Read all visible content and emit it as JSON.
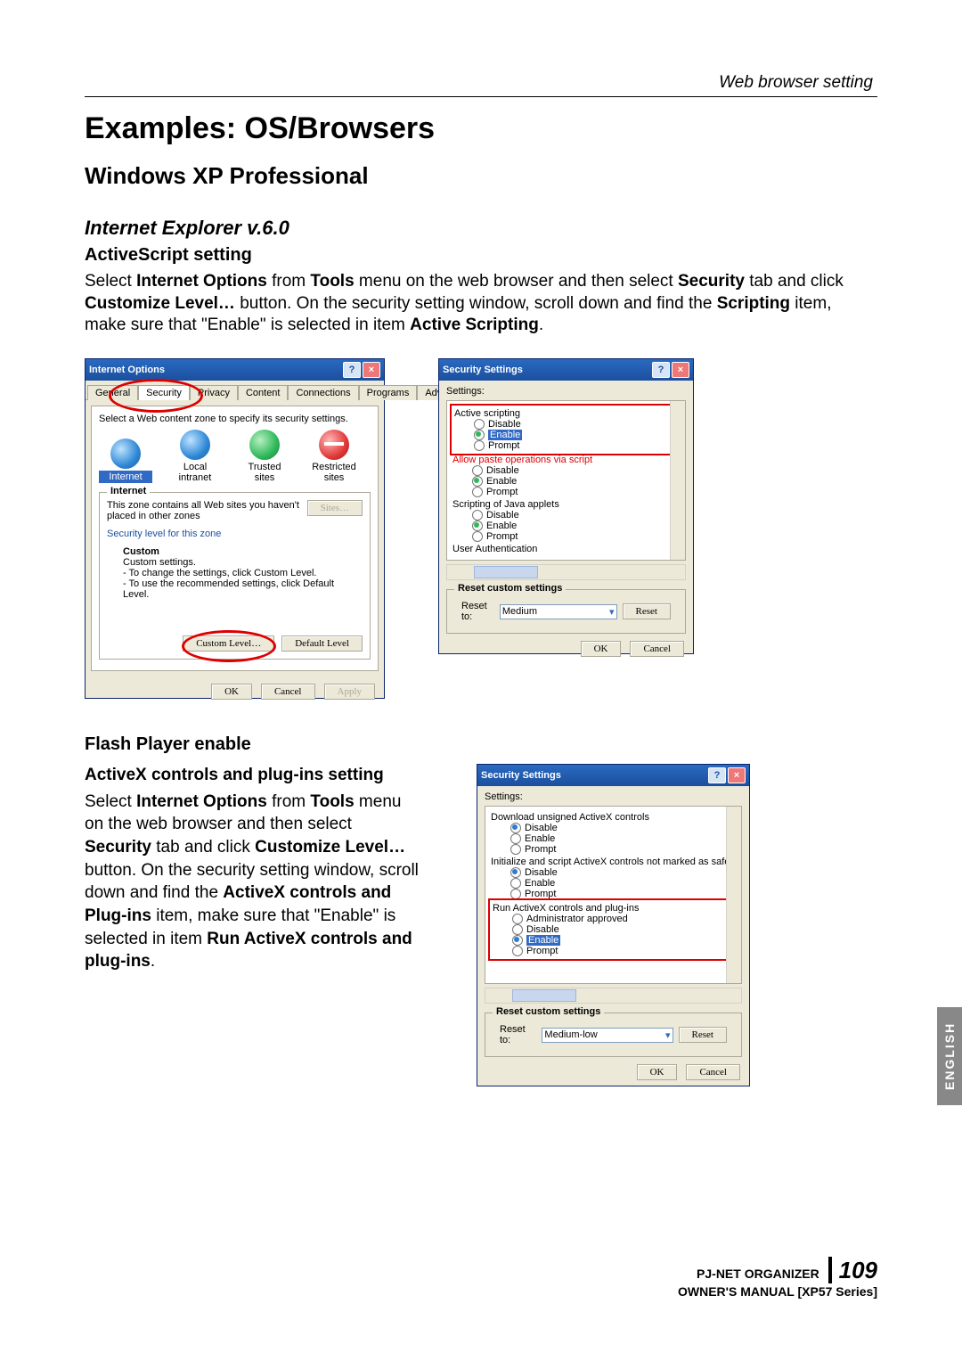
{
  "header": {
    "section": "Web browser setting"
  },
  "h1": "Examples: OS/Browsers",
  "os": "Windows XP Professional",
  "browser": "Internet Explorer v.6.0",
  "section1": {
    "title": "ActiveScript setting",
    "body_parts": {
      "p1a": "Select ",
      "p1b": "Internet Options",
      "p1c": " from ",
      "p1d": "Tools",
      "p1e": " menu on the web browser and then select ",
      "p1f": "Security",
      "p1g": " tab and click ",
      "p1h": "Customize Level…",
      "p1i": " button. On the security setting window, scroll down and find the ",
      "p1j": "Scripting",
      "p1k": " item, make sure that \"Enable\" is selected in item ",
      "p1l": "Active Scripting",
      "p1m": "."
    }
  },
  "section2": {
    "title": "Flash Player enable",
    "sub": "ActiveX controls and plug-ins setting",
    "body_parts": {
      "a": "Select ",
      "b": "Internet Options",
      "c": " from ",
      "d": "Tools",
      "e": " menu on the web browser and then select ",
      "f": "Security",
      "g": " tab and click ",
      "h": "Customize Level…",
      "i": " button. On the security setting window, scroll down and find the ",
      "j": "ActiveX controls and Plug-ins",
      "k": " item, make sure that \"Enable\" is selected in item ",
      "l": "Run ActiveX controls and plug-ins",
      "m": "."
    }
  },
  "dlg_internet_options": {
    "title": "Internet Options",
    "tabs": [
      "General",
      "Security",
      "Privacy",
      "Content",
      "Connections",
      "Programs",
      "Advanced"
    ],
    "hint": "Select a Web content zone to specify its security settings.",
    "zones": [
      "Internet",
      "Local intranet",
      "Trusted sites",
      "Restricted sites"
    ],
    "zone_group_title": "Internet",
    "zone_desc": "This zone contains all Web sites you haven't placed in other zones",
    "sites_btn": "Sites…",
    "sec_label": "Security level for this zone",
    "custom_title": "Custom",
    "custom_l1": "Custom settings.",
    "custom_l2": "- To change the settings, click Custom Level.",
    "custom_l3": "- To use the recommended settings, click Default Level.",
    "btn_custom": "Custom Level…",
    "btn_default": "Default Level",
    "ok": "OK",
    "cancel": "Cancel",
    "apply": "Apply"
  },
  "dlg_sec1": {
    "title": "Security Settings",
    "settings_label": "Settings:",
    "g1": "Active scripting",
    "enable": "Enable",
    "disable": "Disable",
    "prompt": "Prompt",
    "g2": "Allow paste operations via script",
    "g3": "Scripting of Java applets",
    "g4": "User Authentication",
    "reset_group": "Reset custom settings",
    "reset_to": "Reset to:",
    "reset_val": "Medium",
    "reset_btn": "Reset",
    "ok": "OK",
    "cancel": "Cancel"
  },
  "dlg_sec2": {
    "title": "Security Settings",
    "settings_label": "Settings:",
    "g1": "Download unsigned ActiveX controls",
    "g2": "Initialize and script ActiveX controls not marked as safe",
    "g3": "Run ActiveX controls and plug-ins",
    "opt_admin": "Administrator approved",
    "enable": "Enable",
    "disable": "Disable",
    "prompt": "Prompt",
    "reset_group": "Reset custom settings",
    "reset_to": "Reset to:",
    "reset_val": "Medium-low",
    "reset_btn": "Reset",
    "ok": "OK",
    "cancel": "Cancel"
  },
  "side_tab": "ENGLISH",
  "footer": {
    "l1": "PJ-NET ORGANIZER",
    "l2": "OWNER'S MANUAL [XP57 Series]",
    "page": "109"
  }
}
